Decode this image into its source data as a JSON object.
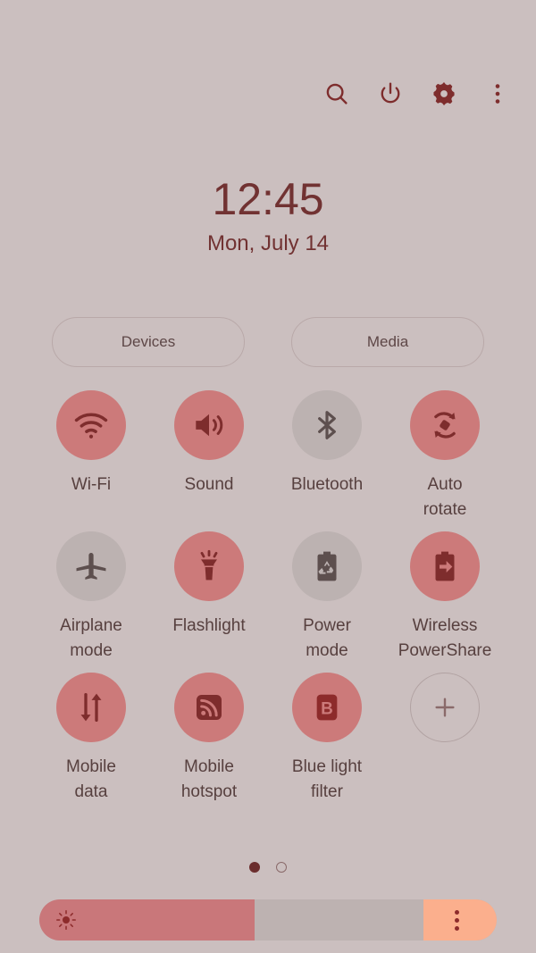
{
  "colors": {
    "background": "#cbbfbf",
    "accent_on": "#cc7a7a",
    "icon_on": "#7e2d2d",
    "tile_off": "#bcb2b1",
    "icon_off": "#5d4f4e",
    "text": "#57403f",
    "clock_text": "#713232",
    "slider_fill": "#c9777a",
    "slider_track": "#bdb2b1",
    "slider_end": "#fbaf8d"
  },
  "topbar": {
    "icons": [
      {
        "name": "search-icon",
        "label": "Search"
      },
      {
        "name": "power-icon",
        "label": "Power"
      },
      {
        "name": "gear-icon",
        "label": "Settings"
      },
      {
        "name": "overflow-menu-icon",
        "label": "More options"
      }
    ]
  },
  "clock": {
    "time": "12:45",
    "date": "Mon, July 14"
  },
  "shortcuts": {
    "devices_label": "Devices",
    "media_label": "Media"
  },
  "quick_settings": {
    "tiles": [
      {
        "label": "Wi-Fi",
        "icon": "wifi-icon",
        "state": "on"
      },
      {
        "label": "Sound",
        "icon": "sound-icon",
        "state": "on"
      },
      {
        "label": "Bluetooth",
        "icon": "bluetooth-icon",
        "state": "off"
      },
      {
        "label": "Auto\nrotate",
        "icon": "auto-rotate-icon",
        "state": "on"
      },
      {
        "label": "Airplane\nmode",
        "icon": "airplane-icon",
        "state": "off"
      },
      {
        "label": "Flashlight",
        "icon": "flashlight-icon",
        "state": "on"
      },
      {
        "label": "Power\nmode",
        "icon": "power-mode-icon",
        "state": "off"
      },
      {
        "label": "Wireless\nPowerShare",
        "icon": "wireless-powershare-icon",
        "state": "on"
      },
      {
        "label": "Mobile\ndata",
        "icon": "mobile-data-icon",
        "state": "on"
      },
      {
        "label": "Mobile\nhotspot",
        "icon": "mobile-hotspot-icon",
        "state": "on"
      },
      {
        "label": "Blue light\nfilter",
        "icon": "blue-light-filter-icon",
        "state": "on"
      },
      {
        "label": "",
        "icon": "add-icon",
        "state": "add"
      }
    ]
  },
  "pagination": {
    "total_pages": 2,
    "current_page": 1
  },
  "brightness": {
    "value_percent": 47,
    "icon": "brightness-sun-icon",
    "menu_icon": "brightness-options-icon"
  }
}
